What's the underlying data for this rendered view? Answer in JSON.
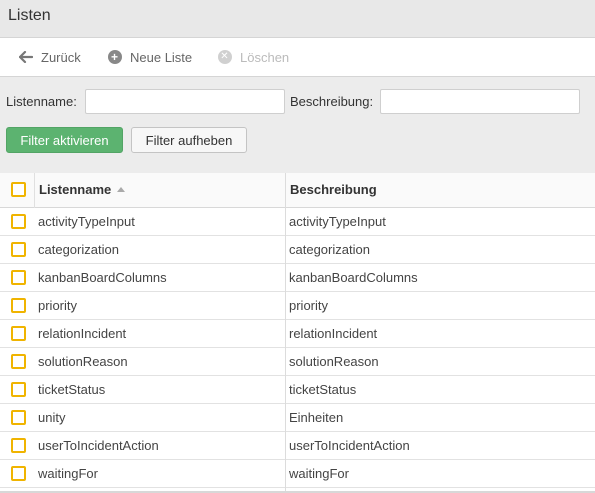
{
  "title": "Listen",
  "toolbar": {
    "back_label": "Zurück",
    "new_label": "Neue Liste",
    "delete_label": "Löschen"
  },
  "filter": {
    "name_label": "Listenname:",
    "name_value": "",
    "description_label": "Beschreibung:",
    "description_value": "",
    "activate_label": "Filter aktivieren",
    "clear_label": "Filter aufheben"
  },
  "table": {
    "columns": [
      "Listenname",
      "Beschreibung"
    ],
    "sort": {
      "column": "Listenname",
      "direction": "ascending"
    },
    "rows": [
      {
        "name": "activityTypeInput",
        "description": "activityTypeInput"
      },
      {
        "name": "categorization",
        "description": "categorization"
      },
      {
        "name": "kanbanBoardColumns",
        "description": "kanbanBoardColumns"
      },
      {
        "name": "priority",
        "description": "priority"
      },
      {
        "name": "relationIncident",
        "description": "relationIncident"
      },
      {
        "name": "solutionReason",
        "description": "solutionReason"
      },
      {
        "name": "ticketStatus",
        "description": "ticketStatus"
      },
      {
        "name": "unity",
        "description": "Einheiten"
      },
      {
        "name": "userToIncidentAction",
        "description": "userToIncidentAction"
      },
      {
        "name": "waitingFor",
        "description": "waitingFor"
      }
    ]
  },
  "icons": {
    "back": "arrow-left-icon",
    "new": "plus-circle-icon",
    "delete": "x-circle-icon",
    "checkbox": "checkbox-icon"
  },
  "colors": {
    "accent_green": "#5cb370",
    "checkbox_border": "#f0b400"
  }
}
